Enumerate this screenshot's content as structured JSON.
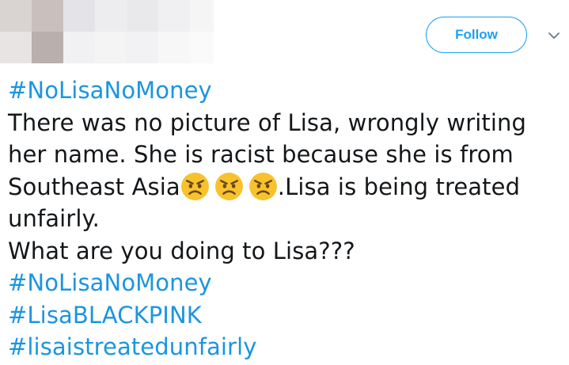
{
  "header": {
    "follow_label": "Follow",
    "caret_icon": "chevron-down-icon"
  },
  "tweet": {
    "hashtag_top": "#NoLisaNoMoney",
    "line1": "There was no picture of Lisa, wrongly writing",
    "line2": "her name. She is racist because she is from",
    "line3_start": "Southeast Asia",
    "line3_emoji": [
      "angry-face-icon",
      "angry-face-icon",
      "angry-face-icon"
    ],
    "line3_end": ".Lisa is being treated",
    "line4": "unfairly.",
    "line5": "What are you doing to Lisa???",
    "hashtags_bottom": [
      "#NoLisaNoMoney",
      "#LisaBLACKPINK",
      "#lisaistreatedunfairly"
    ]
  },
  "colors": {
    "accent": "#1da1f2",
    "hashtag": "#1b95e0",
    "text": "#14171a",
    "emoji_face": "#f8c22d"
  }
}
